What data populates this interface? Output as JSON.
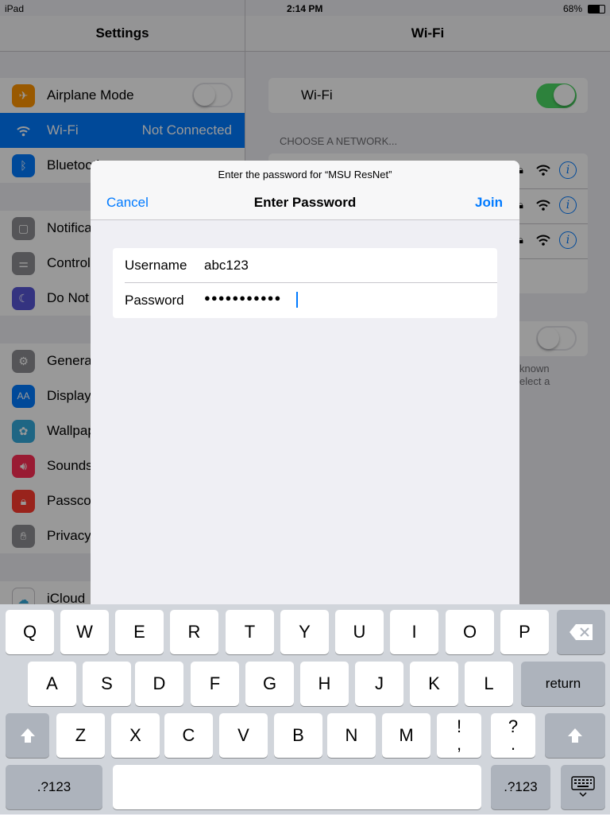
{
  "status_bar": {
    "device": "iPad",
    "time": "2:14 PM",
    "battery": "68%"
  },
  "settings": {
    "title": "Settings",
    "items": [
      {
        "label": "Airplane Mode",
        "icon": "airplane-icon",
        "color": "#ff9500"
      },
      {
        "label": "Wi-Fi",
        "value": "Not Connected",
        "icon": "wifi-icon",
        "color": "#007aff"
      },
      {
        "label": "Bluetooth",
        "icon": "bluetooth-icon",
        "color": "#007aff"
      },
      {
        "label": "Notification Center",
        "icon": "notifications-icon",
        "color": "#8e8e93"
      },
      {
        "label": "Control Center",
        "icon": "control-center-icon",
        "color": "#8e8e93"
      },
      {
        "label": "Do Not Disturb",
        "icon": "moon-icon",
        "color": "#5856d6"
      },
      {
        "label": "General",
        "icon": "gear-icon",
        "color": "#8e8e93"
      },
      {
        "label": "Display & Brightness",
        "icon": "display-icon",
        "color": "#007aff"
      },
      {
        "label": "Wallpaper",
        "icon": "wallpaper-icon",
        "color": "#34aadc"
      },
      {
        "label": "Sounds",
        "icon": "speaker-icon",
        "color": "#ff2d55"
      },
      {
        "label": "Passcode",
        "icon": "lock-icon",
        "color": "#ff3b30"
      },
      {
        "label": "Privacy",
        "icon": "hand-icon",
        "color": "#8e8e93"
      },
      {
        "label": "iCloud",
        "icon": "cloud-icon",
        "color": "#ffffff"
      }
    ]
  },
  "wifi": {
    "title": "Wi-Fi",
    "toggle_label": "Wi-Fi",
    "section_header": "CHOOSE A NETWORK...",
    "ask_note_1": "known",
    "ask_note_2": "elect a"
  },
  "dialog": {
    "prompt": "Enter the password for “MSU ResNet”",
    "title": "Enter Password",
    "cancel": "Cancel",
    "join": "Join",
    "username_label": "Username",
    "username_value": "abc123",
    "password_label": "Password",
    "password_value": "●●●●●●●●●●●"
  },
  "keyboard": {
    "row1": [
      "Q",
      "W",
      "E",
      "R",
      "T",
      "Y",
      "U",
      "I",
      "O",
      "P"
    ],
    "row2": [
      "A",
      "S",
      "D",
      "F",
      "G",
      "H",
      "J",
      "K",
      "L"
    ],
    "row3": [
      "Z",
      "X",
      "C",
      "V",
      "B",
      "N",
      "M",
      "!\n,",
      "?\n."
    ],
    "return_label": "return",
    "numbers_label": ".?123",
    "backspace_icon": "backspace-icon",
    "shift_icon": "shift-icon",
    "hide_keyboard_icon": "keyboard-hide-icon"
  },
  "colors": {
    "accent": "#007aff",
    "toggle_on": "#4cd964"
  }
}
